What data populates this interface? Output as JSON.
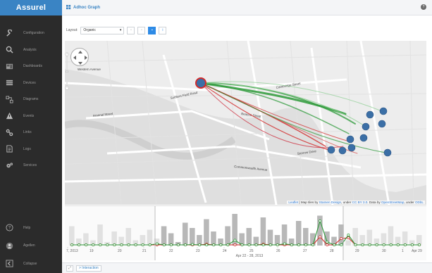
{
  "app": {
    "brand": "Assurel"
  },
  "sidebar": {
    "items": [
      {
        "label": "Configuration",
        "icon": "wrench-icon"
      },
      {
        "label": "Analysis",
        "icon": "search-icon"
      },
      {
        "label": "Dashboards",
        "icon": "dashboard-icon"
      },
      {
        "label": "Devices",
        "icon": "list-icon"
      },
      {
        "label": "Diagrams",
        "icon": "diagram-icon"
      },
      {
        "label": "Events",
        "icon": "warning-icon"
      },
      {
        "label": "Links",
        "icon": "link-icon"
      },
      {
        "label": "Logs",
        "icon": "document-icon"
      },
      {
        "label": "Services",
        "icon": "gears-icon"
      }
    ],
    "bottom": [
      {
        "label": "Help",
        "icon": "help-icon"
      },
      {
        "label": "Agellen",
        "icon": "user-icon"
      },
      {
        "label": "Collapse",
        "icon": "collapse-icon"
      }
    ]
  },
  "topbar": {
    "title": "Adhoc Graph",
    "title_icon": "grid-icon",
    "help_glyph": "?"
  },
  "toolbar": {
    "layout_label": "Layout:",
    "layout_value": "Organic",
    "buttons": [
      "layout-grid",
      "layout-list",
      "layout-map",
      "info"
    ]
  },
  "map": {
    "attribution_parts": [
      {
        "text": "Leaflet",
        "link": true
      },
      {
        "text": " | Map tiles by ",
        "link": false
      },
      {
        "text": "Stamen Design",
        "link": true
      },
      {
        "text": ", under ",
        "link": false
      },
      {
        "text": "CC BY 3.0",
        "link": true
      },
      {
        "text": ". Data by ",
        "link": false
      },
      {
        "text": "OpenStreetMap",
        "link": true
      },
      {
        "text": ", under ",
        "link": false
      },
      {
        "text": "ODbL",
        "link": true
      }
    ],
    "labels": [
      "Cambridge Street",
      "Soldiers Field Road",
      "Arsenal Street",
      "Storrow Drive",
      "Commonwealth Avenue",
      "Beacon Street",
      "Western Avenue"
    ],
    "link_colors": {
      "green": "#2e9a3a",
      "red": "#d22a2a",
      "node": "#3b6fa6",
      "source_ring": "#d22a2a"
    }
  },
  "timeline": {
    "ticks": [
      {
        "label": "7, 2013",
        "faded": true
      },
      {
        "label": "19",
        "faded": true
      },
      {
        "label": "20",
        "faded": true
      },
      {
        "label": "21",
        "faded": true
      },
      {
        "label": "22",
        "faded": false
      },
      {
        "label": "23",
        "faded": false
      },
      {
        "label": "24",
        "faded": false
      },
      {
        "label": "25",
        "faded": false
      },
      {
        "label": "26",
        "faded": false
      },
      {
        "label": "27",
        "faded": false
      },
      {
        "label": "28",
        "faded": false
      },
      {
        "label": "29",
        "faded": true
      },
      {
        "label": "30",
        "faded": true
      },
      {
        "label": "1",
        "faded": true
      },
      {
        "label": "Apr 29",
        "faded": true
      }
    ],
    "range_label": "Apr 22 - 28, 2013",
    "selection_days": [
      "22",
      "28"
    ]
  },
  "chart_data": {
    "type": "bar",
    "title": "",
    "range": "Apr 22 - 28, 2013",
    "bar_heights_relative": [
      0.55,
      0.2,
      0.35,
      0.15,
      0.6,
      0.1,
      0.4,
      0.25,
      0.5,
      0.15,
      0.3,
      0.45,
      0.2,
      0.55,
      0.35,
      0.1,
      0.65,
      0.5,
      0.3,
      0.75,
      0.4,
      0.2,
      0.55,
      0.9,
      0.35,
      0.5,
      0.25,
      0.8,
      0.45,
      0.3,
      0.6,
      0.2,
      0.7,
      0.5,
      0.35,
      0.85,
      0.4,
      0.25,
      0.6,
      0.15,
      0.5,
      0.3,
      0.45,
      0.2,
      0.35,
      0.55,
      0.25,
      0.4,
      0.15,
      0.3
    ],
    "green_line": [
      0.02,
      0.02,
      0.02,
      0.02,
      0.02,
      0.02,
      0.02,
      0.02,
      0.02,
      0.02,
      0.02,
      0.02,
      0.05,
      0.02,
      0.02,
      0.02,
      0.02,
      0.03,
      0.02,
      0.02,
      0.02,
      0.02,
      0.02,
      0.15,
      0.02,
      0.02,
      0.02,
      0.02,
      0.02,
      0.02,
      0.05,
      0.02,
      0.02,
      0.02,
      0.02,
      0.7,
      0.1,
      0.02,
      0.02,
      0.3,
      0.02,
      0.02,
      0.02,
      0.02,
      0.02,
      0.02,
      0.02,
      0.02,
      0.02,
      0.02
    ],
    "red_line": [
      0.02,
      0.02,
      0.02,
      0.02,
      0.02,
      0.02,
      0.02,
      0.02,
      0.02,
      0.02,
      0.02,
      0.02,
      0.02,
      0.02,
      0.02,
      0.02,
      0.02,
      0.02,
      0.02,
      0.04,
      0.02,
      0.02,
      0.02,
      0.02,
      0.02,
      0.02,
      0.02,
      0.04,
      0.02,
      0.02,
      0.02,
      0.02,
      0.02,
      0.02,
      0.02,
      0.25,
      0.02,
      0.02,
      0.2,
      0.22,
      0.02,
      0.02,
      0.02,
      0.02,
      0.02,
      0.02,
      0.02,
      0.02,
      0.02,
      0.02
    ]
  }
}
